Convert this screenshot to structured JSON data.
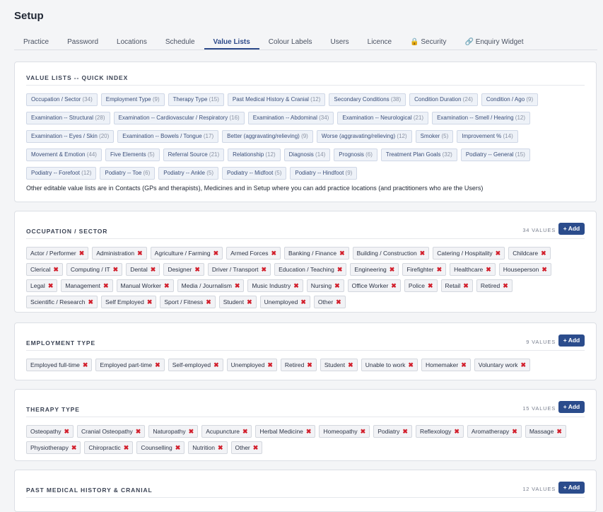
{
  "page": {
    "title": "Setup"
  },
  "tabs": [
    {
      "label": "Practice"
    },
    {
      "label": "Password"
    },
    {
      "label": "Locations"
    },
    {
      "label": "Schedule"
    },
    {
      "label": "Value Lists",
      "active": true
    },
    {
      "label": "Colour Labels"
    },
    {
      "label": "Users"
    },
    {
      "label": "Licence"
    },
    {
      "label": "🔒 Security"
    },
    {
      "label": "🔗 Enquiry Widget"
    }
  ],
  "quick_index": {
    "title": "VALUE LISTS -- QUICK INDEX",
    "items": [
      {
        "label": "Occupation / Sector",
        "count": "(34)"
      },
      {
        "label": "Employment Type",
        "count": "(9)"
      },
      {
        "label": "Therapy Type",
        "count": "(15)"
      },
      {
        "label": "Past Medical History & Cranial",
        "count": "(12)"
      },
      {
        "label": "Secondary Conditions",
        "count": "(38)"
      },
      {
        "label": "Condition Duration",
        "count": "(24)"
      },
      {
        "label": "Condition / Ago",
        "count": "(9)"
      },
      {
        "label": "Examination -- Structural",
        "count": "(28)"
      },
      {
        "label": "Examination -- Cardiovascular / Respiratory",
        "count": "(16)"
      },
      {
        "label": "Examination -- Abdominal",
        "count": "(34)"
      },
      {
        "label": "Examination -- Neurological",
        "count": "(21)"
      },
      {
        "label": "Examination -- Smell / Hearing",
        "count": "(12)"
      },
      {
        "label": "Examination -- Eyes / Skin",
        "count": "(20)"
      },
      {
        "label": "Examination -- Bowels / Tongue",
        "count": "(17)"
      },
      {
        "label": "Better (aggravating/relieving)",
        "count": "(9)"
      },
      {
        "label": "Worse (aggravating/relieving)",
        "count": "(12)"
      },
      {
        "label": "Smoker",
        "count": "(5)"
      },
      {
        "label": "Improvement %",
        "count": "(14)"
      },
      {
        "label": "Movement & Emotion",
        "count": "(44)"
      },
      {
        "label": "Five Elements",
        "count": "(5)"
      },
      {
        "label": "Referral Source",
        "count": "(21)"
      },
      {
        "label": "Relationship",
        "count": "(12)"
      },
      {
        "label": "Diagnosis",
        "count": "(14)"
      },
      {
        "label": "Prognosis",
        "count": "(6)"
      },
      {
        "label": "Treatment Plan Goals",
        "count": "(32)"
      },
      {
        "label": "Podiatry -- General",
        "count": "(15)"
      },
      {
        "label": "Podiatry -- Forefoot",
        "count": "(12)"
      },
      {
        "label": "Podiatry -- Toe",
        "count": "(6)"
      },
      {
        "label": "Podiatry -- Ankle",
        "count": "(5)"
      },
      {
        "label": "Podiatry -- Midfoot",
        "count": "(5)"
      },
      {
        "label": "Podiatry -- Hindfoot",
        "count": "(9)"
      }
    ],
    "note": "Other editable value lists are in Contacts (GPs and therapists), Medicines and in Setup where you can add practice locations (and practitioners who are the Users)"
  },
  "lists": [
    {
      "title": "OCCUPATION / SECTOR",
      "count": "34 VALUES",
      "add_label": "+ Add",
      "values": [
        "Actor / Performer",
        "Administration",
        "Agriculture / Farming",
        "Armed Forces",
        "Banking / Finance",
        "Building / Construction",
        "Catering / Hospitality",
        "Childcare",
        "Clerical",
        "Computing / IT",
        "Dental",
        "Designer",
        "Driver / Transport",
        "Education / Teaching",
        "Engineering",
        "Firefighter",
        "Healthcare",
        "Houseperson",
        "Legal",
        "Management",
        "Manual Worker",
        "Media / Journalism",
        "Music Industry",
        "Nursing",
        "Office Worker",
        "Police",
        "Retail",
        "Retired",
        "Scientific / Research",
        "Self Employed",
        "Sport / Fitness",
        "Student",
        "Unemployed",
        "Other"
      ]
    },
    {
      "title": "EMPLOYMENT TYPE",
      "count": "9 VALUES",
      "add_label": "+ Add",
      "values": [
        "Employed full-time",
        "Employed part-time",
        "Self-employed",
        "Unemployed",
        "Retired",
        "Student",
        "Unable to work",
        "Homemaker",
        "Voluntary work"
      ]
    },
    {
      "title": "THERAPY TYPE",
      "count": "15 VALUES",
      "add_label": "+ Add",
      "values": [
        "Osteopathy",
        "Cranial Osteopathy",
        "Naturopathy",
        "Acupuncture",
        "Herbal Medicine",
        "Homeopathy",
        "Podiatry",
        "Reflexology",
        "Aromatherapy",
        "Massage",
        "Physiotherapy",
        "Chiropractic",
        "Counselling",
        "Nutrition",
        "Other"
      ]
    },
    {
      "title": "PAST MEDICAL HISTORY & CRANIAL",
      "count": "12 VALUES",
      "add_label": "+ Add",
      "values": []
    }
  ],
  "remove_glyph": "✖"
}
